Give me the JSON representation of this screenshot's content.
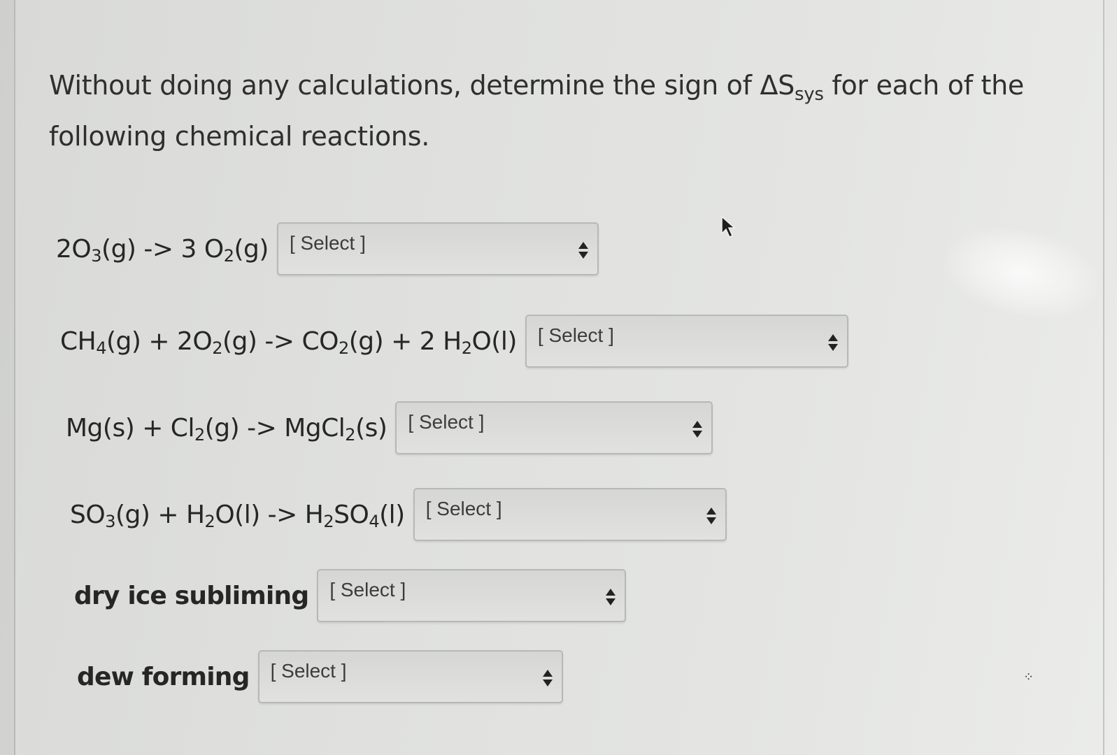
{
  "question": {
    "prefix": "Without doing any calculations, determine the sign of",
    "delta_symbol": "ΔS",
    "subscript": "sys",
    "suffix_line1": "for each of the",
    "line2": "following chemical reactions."
  },
  "reactions": [
    {
      "label_parts": [
        "2O",
        "3",
        "(g) -> 3 O",
        "2",
        "(g)"
      ],
      "select_value": "[ Select ]"
    },
    {
      "label_parts": [
        "CH",
        "4",
        "(g) + 2O",
        "2",
        "(g) -> CO",
        "2",
        "(g) + 2 H",
        "2",
        "O(l)"
      ],
      "select_value": "[ Select ]"
    },
    {
      "label_parts": [
        "Mg(s) + Cl",
        "2",
        "(g) -> MgCl",
        "2",
        "(s)"
      ],
      "select_value": "[ Select ]"
    },
    {
      "label_parts": [
        "SO",
        "3",
        "(g) + H",
        "2",
        "O(l) -> H",
        "2",
        "SO",
        "4",
        "(l)"
      ],
      "select_value": "[ Select ]"
    },
    {
      "label": "dry ice subliming",
      "select_value": "[ Select ]"
    },
    {
      "label": "dew forming",
      "select_value": "[ Select ]"
    }
  ],
  "icons": {
    "dropdown": "sort-arrows-icon",
    "pointer": "mouse-cursor-icon"
  }
}
